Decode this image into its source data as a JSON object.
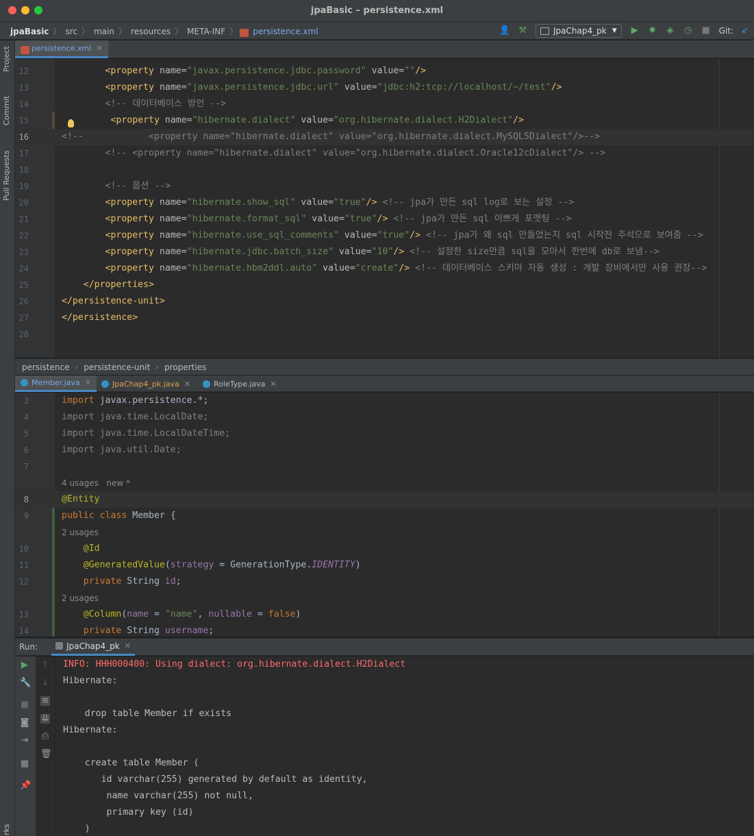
{
  "window": {
    "title": "jpaBasic – persistence.xml"
  },
  "navbar": {
    "breadcrumbs": [
      "jpaBasic",
      "src",
      "main",
      "resources",
      "META-INF"
    ],
    "current_file": "persistence.xml",
    "run_config": "JpaChap4_pk",
    "git_label": "Git:"
  },
  "left_strip": {
    "tabs": [
      "Project",
      "Commit",
      "Pull Requests",
      "rks"
    ]
  },
  "top_editor": {
    "tab": "persistence.xml",
    "lines": [
      {
        "n": "12",
        "code": "        <property name=\"javax.persistence.jdbc.password\" value=\"\"/>"
      },
      {
        "n": "13",
        "code": "        <property name=\"javax.persistence.jdbc.url\" value=\"jdbc:h2:tcp://localhost/~/test\"/>"
      },
      {
        "n": "14",
        "code": "        <!-- 데이터베이스 방언 -->"
      },
      {
        "n": "15",
        "code": "         <property name=\"hibernate.dialect\" value=\"org.hibernate.dialect.H2Dialect\"/>"
      },
      {
        "n": "16",
        "code": "<!--            <property name=\"hibernate.dialect\" value=\"org.hibernate.dialect.MySQL5Dialect\"/>-->"
      },
      {
        "n": "17",
        "code": "        <!-- <property name=\"hibernate.dialect\" value=\"org.hibernate.dialect.Oracle12cDialect\"/> -->"
      },
      {
        "n": "18",
        "code": ""
      },
      {
        "n": "19",
        "code": "        <!-- 옵션 -->"
      },
      {
        "n": "20",
        "code": "        <property name=\"hibernate.show_sql\" value=\"true\"/> <!-- jpa가 만든 sql log로 보는 설정 -->"
      },
      {
        "n": "21",
        "code": "        <property name=\"hibernate.format_sql\" value=\"true\"/> <!-- jpa가 만든 sql 이쁘게 포맷팅 -->"
      },
      {
        "n": "22",
        "code": "        <property name=\"hibernate.use_sql_comments\" value=\"true\"/> <!-- jpa가 왜 sql 만들었는지 sql 시작전 주석으로 보여줌 -->"
      },
      {
        "n": "23",
        "code": "        <property name=\"hibernate.jdbc.batch_size\" value=\"10\"/> <!-- 설정한 size만큼 sql을 모아서 한번에 db로 보냄-->"
      },
      {
        "n": "24",
        "code": "        <property name=\"hibernate.hbm2ddl.auto\" value=\"create\"/> <!-- 데이터베이스 스키마 자동 생성 : 개발 장비에서만 사용 권장-->"
      },
      {
        "n": "25",
        "code": "    </properties>"
      },
      {
        "n": "26",
        "code": "</persistence-unit>"
      },
      {
        "n": "27",
        "code": "</persistence>"
      },
      {
        "n": "28",
        "code": ""
      }
    ]
  },
  "structure_breadcrumb": [
    "persistence",
    "persistence-unit",
    "properties"
  ],
  "bottom_editor": {
    "tabs": [
      {
        "label": "Member.java",
        "color": "#7ca8e8"
      },
      {
        "label": "JpaChap4_pk.java",
        "color": "#e0a050"
      },
      {
        "label": "RoleType.java",
        "color": "#bbbbbb"
      }
    ],
    "lines": [
      {
        "n": "3",
        "code": "import javax.persistence.*;"
      },
      {
        "n": "4",
        "code": "import java.time.LocalDate;"
      },
      {
        "n": "5",
        "code": "import java.time.LocalDateTime;"
      },
      {
        "n": "6",
        "code": "import java.util.Date;"
      },
      {
        "n": "7",
        "code": ""
      },
      {
        "n": "",
        "code": "4 usages   new *"
      },
      {
        "n": "8",
        "code": "@Entity"
      },
      {
        "n": "9",
        "code": "public class Member {"
      },
      {
        "n": "",
        "code": "2 usages"
      },
      {
        "n": "10",
        "code": "    @Id"
      },
      {
        "n": "11",
        "code": "    @GeneratedValue(strategy = GenerationType.IDENTITY)"
      },
      {
        "n": "12",
        "code": "    private String id;"
      },
      {
        "n": "",
        "code": "2 usages"
      },
      {
        "n": "13",
        "code": "    @Column(name = \"name\", nullable = false)"
      },
      {
        "n": "14",
        "code": "    private String username;"
      }
    ]
  },
  "run_panel": {
    "label": "Run:",
    "tab": "JpaChap4_pk",
    "console": [
      "INFO: HHH000400: Using dialect: org.hibernate.dialect.H2Dialect",
      "Hibernate: ",
      "",
      "    drop table Member if exists",
      "Hibernate: ",
      "",
      "    create table Member (",
      "       id varchar(255) generated by default as identity,",
      "        name varchar(255) not null,",
      "        primary key (id)",
      "    )"
    ]
  }
}
